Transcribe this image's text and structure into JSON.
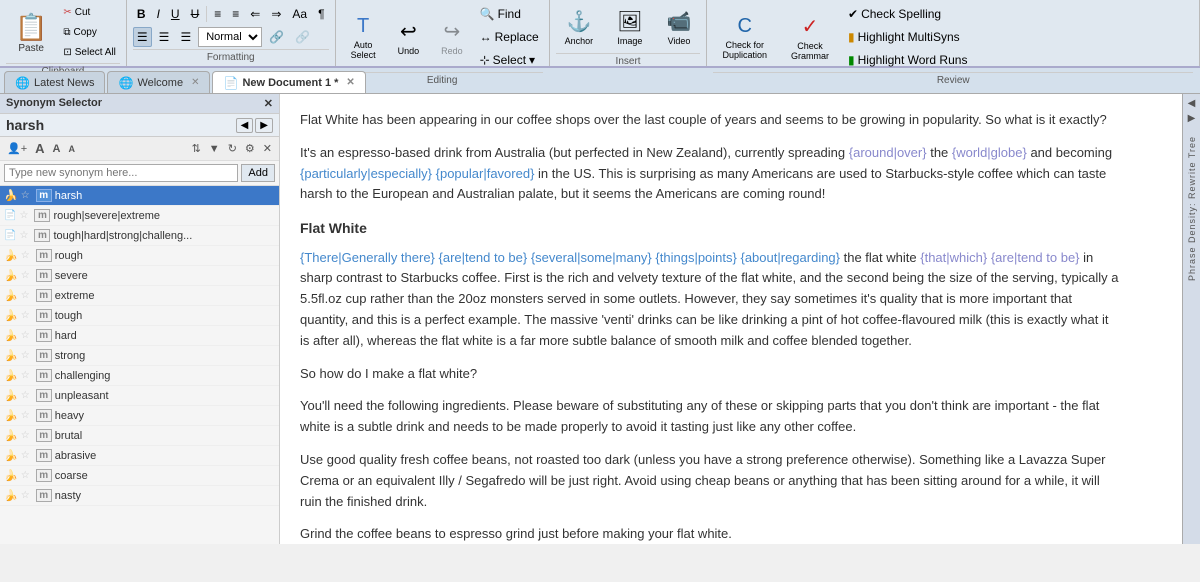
{
  "ribbon": {
    "clipboard_label": "Clipboard",
    "formatting_label": "Formatting",
    "editing_label": "Editing",
    "insert_label": "Insert",
    "review_label": "Review",
    "paste_label": "Paste",
    "cut_label": "Cut",
    "copy_label": "Copy",
    "select_all_label": "Select All",
    "bold_label": "B",
    "italic_label": "I",
    "underline_label": "U",
    "strikethrough_label": "U",
    "bullets_label": "≡",
    "numbering_label": "≡",
    "indent_dec_label": "⇐",
    "indent_inc_label": "⇒",
    "case_label": "Aa",
    "paragraph_label": "¶",
    "align_left_label": "≡",
    "align_center_label": "≡",
    "align_right_label": "≡",
    "normal_dropdown": "Normal",
    "link_label": "🔗",
    "unlink_label": "🔗",
    "find_label": "Find",
    "replace_label": "Replace",
    "select_label": "Select",
    "auto_select_label": "Auto\nSelect",
    "undo_label": "Undo",
    "redo_label": "Redo",
    "anchor_label": "Anchor",
    "image_label": "Image",
    "video_label": "Video",
    "check_dup_label": "Check for\nDuplication",
    "check_grammar_label": "Check\nGrammar",
    "check_spelling_label": "Check Spelling",
    "highlight_multi_label": "Highlight MultiSyns",
    "highlight_word_label": "Highlight Word Runs"
  },
  "tabs": [
    {
      "id": "latest-news",
      "label": "Latest News",
      "icon": "🌐",
      "active": false,
      "closeable": false
    },
    {
      "id": "welcome",
      "label": "Welcome",
      "icon": "🌐",
      "active": false,
      "closeable": true
    },
    {
      "id": "new-doc",
      "label": "New Document 1 *",
      "icon": "📄",
      "active": true,
      "closeable": true
    }
  ],
  "synonym_panel": {
    "title": "Synonym Selector",
    "word": "harsh",
    "search_placeholder": "Type new synonym here...",
    "add_btn": "Add",
    "items": [
      {
        "id": 1,
        "text": "harsh",
        "selected": true,
        "has_icon": true
      },
      {
        "id": 2,
        "text": "rough|severe|extreme",
        "selected": false,
        "has_icon": true
      },
      {
        "id": 3,
        "text": "tough|hard|strong|challeng...",
        "selected": false,
        "has_icon": true
      },
      {
        "id": 4,
        "text": "rough",
        "selected": false,
        "has_icon": true
      },
      {
        "id": 5,
        "text": "severe",
        "selected": false,
        "has_icon": true
      },
      {
        "id": 6,
        "text": "extreme",
        "selected": false,
        "has_icon": true
      },
      {
        "id": 7,
        "text": "tough",
        "selected": false,
        "has_icon": true
      },
      {
        "id": 8,
        "text": "hard",
        "selected": false,
        "has_icon": true
      },
      {
        "id": 9,
        "text": "strong",
        "selected": false,
        "has_icon": true
      },
      {
        "id": 10,
        "text": "challenging",
        "selected": false,
        "has_icon": true
      },
      {
        "id": 11,
        "text": "unpleasant",
        "selected": false,
        "has_icon": true
      },
      {
        "id": 12,
        "text": "heavy",
        "selected": false,
        "has_icon": true
      },
      {
        "id": 13,
        "text": "brutal",
        "selected": false,
        "has_icon": true
      },
      {
        "id": 14,
        "text": "abrasive",
        "selected": false,
        "has_icon": true
      },
      {
        "id": 15,
        "text": "coarse",
        "selected": false,
        "has_icon": true
      },
      {
        "id": 16,
        "text": "nasty",
        "selected": false,
        "has_icon": true
      }
    ]
  },
  "document": {
    "title": "Flat White",
    "paragraphs": [
      "Flat White has been appearing in our coffee shops over the last couple of years and seems to be growing in popularity. So what is it exactly?",
      "It's an espresso-based drink from Australia (but perfected in New Zealand), currently spreading {around|over} the {world|globe} and becoming {particularly|especially} {popular|favored} in the US. This is surprising as many Americans are used to Starbucks-style coffee which can taste harsh to the European and Australian palate, but it seems the Americans are coming round!",
      "Flat White",
      "{There|Generally there} {are|tend to be} {several|some|many} {things|points} {about|regarding} the flat white {that|which} {are|tend to be} in sharp contrast to Starbucks coffee. First is the rich and velvety texture of the flat white, and the second being the size of the serving, typically a 5.5fl.oz cup rather than the 20oz monsters served in some outlets. However, they say sometimes it's quality that is more important that quantity, and this is a perfect example. The massive 'venti' drinks can be like drinking a pint of hot coffee-flavoured milk (this is exactly what it is after all), whereas the flat white is a far more subtle balance of smooth milk and coffee blended together.",
      "So how do I make a flat white?",
      "You'll need the following ingredients. Please beware of substituting any of these or skipping parts that you don't think are important - the flat white is a subtle drink and needs to be made properly to avoid it tasting just like any other coffee.",
      "Use good quality fresh coffee beans, not roasted too dark (unless you have a strong preference otherwise). Something like a Lavazza Super Crema or an equivalent Illy / Segafredo will be just right. Avoid using cheap beans or anything that has been sitting around for a while, it will ruin the finished drink.",
      "Grind the coffee beans to espresso grind just before making your flat white."
    ]
  },
  "right_sidebar": {
    "label": "Phrase Density: Rewrite Tree"
  }
}
